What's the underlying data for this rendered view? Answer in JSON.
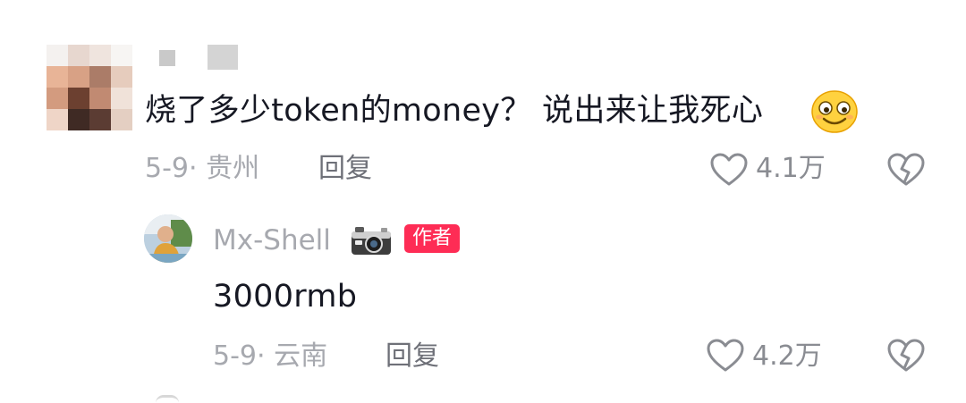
{
  "comment": {
    "text": "烧了多少token的money？ 说出来让我死心",
    "emoji_icon": "slightly-smiling-face-emoji-icon",
    "date_location": "5-9· 贵州",
    "reply_label": "回复",
    "likes": "4.1万"
  },
  "reply": {
    "author_name": "Mx-Shell",
    "camera_badge_icon": "camera-icon",
    "author_badge": "作者",
    "text": "3000rmb",
    "date_location": "5-9· 云南",
    "reply_label": "回复",
    "likes": "4.2万"
  },
  "colors": {
    "text_primary": "#161823",
    "text_secondary": "#a7a9af",
    "author_badge": "#fe2c55"
  },
  "icons": [
    "heart-outline-icon",
    "broken-heart-icon"
  ]
}
